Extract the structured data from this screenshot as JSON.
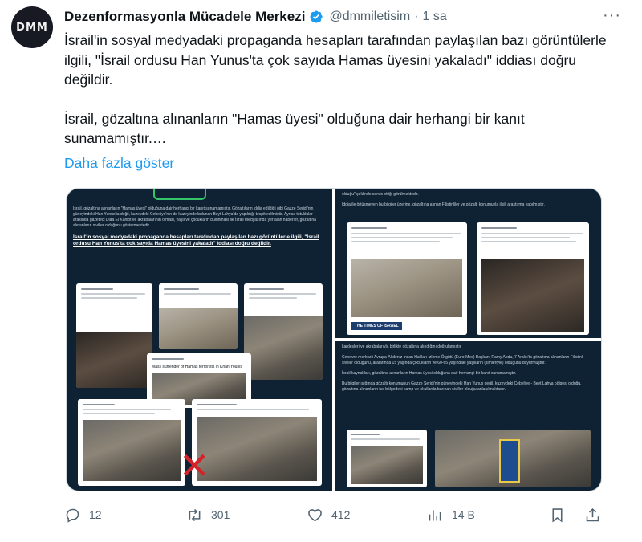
{
  "author": {
    "avatar_text": "DMM",
    "name": "Dezenformasyonla Mücadele Merkezi",
    "handle": "@dmmiletisim",
    "separator": "·",
    "time": "1 sa"
  },
  "tweet": {
    "paragraph1": "İsrail'in  sosyal medyadaki propaganda hesapları tarafından paylaşılan bazı görüntülerle ilgili, \"İsrail ordusu Han Yunus'ta çok sayıda Hamas üyesini yakaladı\" iddiası doğru değildir.",
    "paragraph2": "İsrail, gözaltına alınanların \"Hamas üyesi\" olduğuna dair herhangi bir kanıt sunamamıştır.…",
    "show_more": "Daha fazla göster"
  },
  "media": {
    "left_panel": {
      "body": "İsrail, gözaltına alınanların \"Hamas üyesi\" olduğuna dair herhangi bir kanıt sunamamıştır. Gözaltıların iddia edildiği gibi Gazze Şeridi'nin güneyindeki Han Yunus'ta değil, kuzeydeki Cebeliye'nin de kuzeyinde bulunan Beyt Lahya'da yapıldığı tespit edilmiştir. Ayrıca tutuklular arasında gazeteci Diaa El Kahlot ve akrabalarının olması, yaşlı ve çocukların bulunması ile İsrail medyasında yer alan haberler, gözaltına alınanların siviller olduğunu göstermektedir.",
      "highlight": "İsrail'in  sosyal medyadaki propaganda hesapları tarafından paylaşılan bazı görüntülerle ilgili, \"İsrail ordusu Han Yunus'ta çok sayıda Hamas üyesini yakaladı\" iddiası doğru değildir.",
      "card_caption": "Mass surrender of Hamas terrorists in Khan Younis"
    },
    "right_top_panel": {
      "line1": "olduğu\" şeklinde servis ettiği görülmektedir.",
      "line2": "İddia ile örtüşmeyen bu bilgiler üzerine, gözaltına alınan Filistinliler ve gözaltı konumuyla ilgili araştırma yapılmıştır.",
      "logo": "THE TIMES OF ISRAEL"
    },
    "right_bottom_panel": {
      "line1": "kardeşleri ve akrabalarıyla birlikte gözaltına alındığını doğrulamıştır.",
      "line2": "Cenevre merkezli Avrupa-Akdeniz İnsan Hakları İzleme Örgütü (Euro-Med) Başkanı Ramy Abdu, 7 Aralık'ta gözaltına alınanların Filistinli siviller olduğunu, aralarında 15 yaşında çocukların ve 60-65 yaşındaki yaşlıların (simleriyle) olduğunu duyurmuştur.",
      "line3": "İsrail kaynakları, gözaltına alınanların Hamas üyesi olduğuna dair herhangi bir kanıt sunamamıştır.",
      "line4": "Bu bilgiler ışığında gözaltı konumunun Gazze Şeridi'nin güneyindeki Han Yunus değil, kuzeydeki Cebeliye - Beyt Lahya bölgesi olduğu, gözaltına alınanların ise bölgedeki kamp ve okullarda barınan siviller olduğu anlaşılmaktadır."
    }
  },
  "actions": {
    "reply_count": "12",
    "retweet_count": "301",
    "like_count": "412",
    "views_count": "14 B"
  },
  "colors": {
    "link": "#1d9bf0",
    "secondary_text": "#536471",
    "verified": "#1d9bf0",
    "panel_bg": "#0f2233"
  },
  "icons": {
    "verified": "verified-badge-icon",
    "more": "more-options-icon",
    "reply": "reply-icon",
    "retweet": "retweet-icon",
    "like": "heart-icon",
    "views": "views-chart-icon",
    "bookmark": "bookmark-icon",
    "share": "share-icon"
  }
}
